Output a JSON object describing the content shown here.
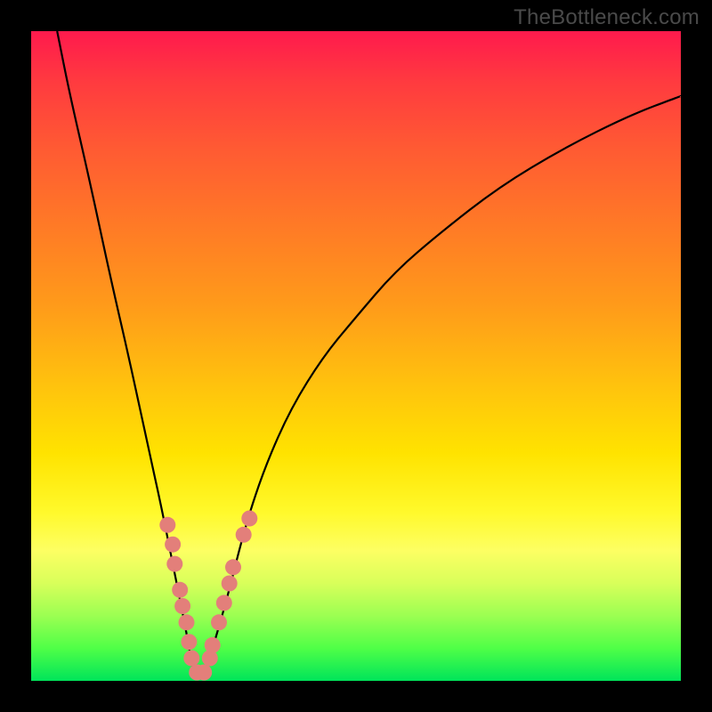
{
  "watermark": "TheBottleneck.com",
  "colors": {
    "frame": "#000000",
    "gradient_top": "#ff1a4d",
    "gradient_bottom": "#00e45a",
    "curve": "#000000",
    "marker": "#e37f7a"
  },
  "chart_data": {
    "type": "line",
    "title": "",
    "xlabel": "",
    "ylabel": "",
    "xlim": [
      0,
      100
    ],
    "ylim": [
      0,
      100
    ],
    "legend": false,
    "grid": false,
    "note": "V-shaped bottleneck curve on a rainbow background. Values estimated from pixel positions; axes are unlabeled so values are normalized 0–100. y is distance from the bottom (higher = redder).",
    "series": [
      {
        "name": "bottleneck-curve",
        "x": [
          4,
          6,
          9,
          12,
          15,
          18,
          20,
          22,
          24,
          25,
          26,
          27,
          30,
          33,
          36,
          40,
          45,
          50,
          56,
          63,
          72,
          82,
          92,
          100
        ],
        "y": [
          100,
          90,
          77,
          63,
          50,
          36,
          27,
          17,
          7,
          1,
          0,
          2,
          12,
          24,
          33,
          42,
          50,
          56,
          63,
          69,
          76,
          82,
          87,
          90
        ]
      }
    ],
    "markers": [
      {
        "x": 21.0,
        "y": 24.0
      },
      {
        "x": 21.8,
        "y": 21.0
      },
      {
        "x": 22.1,
        "y": 18.0
      },
      {
        "x": 22.9,
        "y": 14.0
      },
      {
        "x": 23.3,
        "y": 11.5
      },
      {
        "x": 23.9,
        "y": 9.0
      },
      {
        "x": 24.3,
        "y": 6.0
      },
      {
        "x": 24.7,
        "y": 3.5
      },
      {
        "x": 25.5,
        "y": 1.3
      },
      {
        "x": 26.6,
        "y": 1.3
      },
      {
        "x": 27.5,
        "y": 3.5
      },
      {
        "x": 27.9,
        "y": 5.5
      },
      {
        "x": 28.9,
        "y": 9.0
      },
      {
        "x": 29.7,
        "y": 12.0
      },
      {
        "x": 30.5,
        "y": 15.0
      },
      {
        "x": 31.1,
        "y": 17.5
      },
      {
        "x": 32.7,
        "y": 22.5
      },
      {
        "x": 33.6,
        "y": 25.0
      }
    ]
  }
}
